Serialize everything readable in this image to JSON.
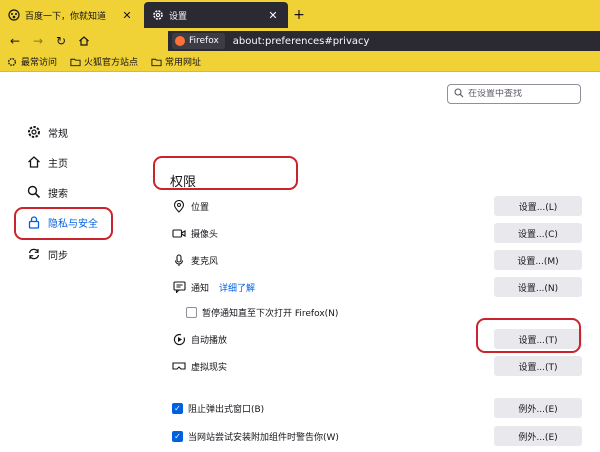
{
  "tabs": [
    {
      "title": "百度一下，你就知道",
      "icon": "baidu-icon",
      "active": false
    },
    {
      "title": "设置",
      "icon": "gear-icon",
      "active": true
    }
  ],
  "newtab_symbol": "+",
  "navbar": {
    "identity_label": "Firefox",
    "url": "about:preferences#privacy"
  },
  "bookmarks": [
    {
      "label": "最常访问",
      "icon": "gear-icon"
    },
    {
      "label": "火狐官方站点",
      "icon": "folder-icon"
    },
    {
      "label": "常用网址",
      "icon": "folder-icon"
    }
  ],
  "search": {
    "placeholder": "在设置中查找"
  },
  "categories": [
    {
      "label": "常规",
      "icon": "gear-icon",
      "selected": false
    },
    {
      "label": "主页",
      "icon": "home-icon",
      "selected": false
    },
    {
      "label": "搜索",
      "icon": "search-icon",
      "selected": false
    },
    {
      "label": "隐私与安全",
      "icon": "lock-icon",
      "selected": true
    },
    {
      "label": "同步",
      "icon": "sync-icon",
      "selected": false
    }
  ],
  "section_title": "权限",
  "permissions": [
    {
      "label": "位置",
      "icon": "location-icon",
      "button": "设置...(L)"
    },
    {
      "label": "摄像头",
      "icon": "camera-icon",
      "button": "设置...(C)"
    },
    {
      "label": "麦克风",
      "icon": "microphone-icon",
      "button": "设置...(M)"
    },
    {
      "label": "通知",
      "icon": "notification-icon",
      "link": "详细了解",
      "button": "设置...(N)"
    },
    {
      "label": "暂停通知直至下次打开 Firefox(N)",
      "checkbox": false
    },
    {
      "label": "自动播放",
      "icon": "autoplay-icon",
      "button": "设置...(T)"
    },
    {
      "label": "虚拟现实",
      "icon": "vr-icon",
      "button": "设置...(T)"
    },
    {
      "label": "阻止弹出式窗口(B)",
      "checkbox": true,
      "button": "例外...(E)"
    },
    {
      "label": "当网站尝试安装附加组件时警告你(W)",
      "checkbox": true,
      "button": "例外...(E)"
    }
  ],
  "colors": {
    "tabstrip": "#f0d236",
    "active_tab": "#2b2a33",
    "accent": "#0061e0",
    "highlight": "#c9242b"
  }
}
